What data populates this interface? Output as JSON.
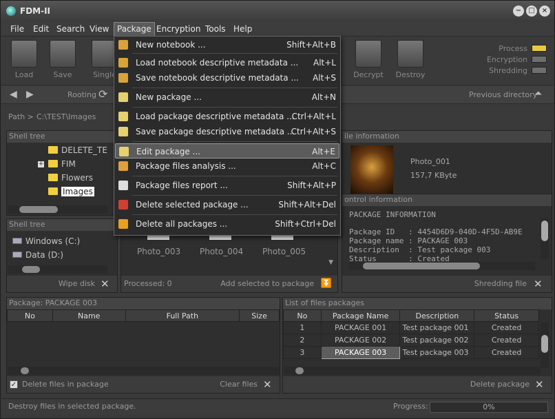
{
  "app": {
    "title": "FDM-II"
  },
  "window_buttons": {
    "minimize": "−",
    "maximize": "□",
    "close": "×"
  },
  "menubar": {
    "file": "File",
    "edit": "Edit",
    "search": "Search",
    "view": "View",
    "package": "Package",
    "encryption": "Encryption",
    "tools": "Tools",
    "help": "Help"
  },
  "toolbar": {
    "load": "Load",
    "save": "Save",
    "single": "Single",
    "decrypt": "Decrypt",
    "destroy": "Destroy"
  },
  "status_lights": {
    "process": {
      "label": "Process",
      "color": "#e8c840"
    },
    "encryption": {
      "label": "Encryption",
      "color": "#6e6e6e"
    },
    "shredding": {
      "label": "Shredding",
      "color": "#6e6e6e"
    }
  },
  "nav": {
    "rooting": "Rooting",
    "previous_directory": "Previous directory"
  },
  "path": {
    "label": "Path >",
    "value": "C:\\TEST\\Images"
  },
  "shell_tree_top": {
    "title": "Shell tree",
    "items": [
      {
        "label": "DELETE_TE"
      },
      {
        "label": "FIM"
      },
      {
        "label": "Flowers"
      },
      {
        "label": "Images"
      }
    ]
  },
  "shell_tree_bottom": {
    "title": "Shell tree",
    "drives": [
      {
        "label": "Windows (C:)"
      },
      {
        "label": "Data (D:)"
      }
    ],
    "wipe_disk": "Wipe disk"
  },
  "thumbnails": {
    "items": [
      {
        "label": "Photo_003"
      },
      {
        "label": "Photo_004"
      },
      {
        "label": "Photo_005"
      }
    ],
    "processed": "Processed: 0",
    "add_selected": "Add selected to package"
  },
  "file_info": {
    "title": "ile information",
    "name": "Photo_001",
    "size": "157,7 KByte"
  },
  "control_info": {
    "title": "ontrol information",
    "header": "PACKAGE INFORMATION",
    "rows": [
      {
        "key": "Package ID  ",
        "value": ": 4454D6D9-040D-4F5D-AB9E"
      },
      {
        "key": "Package name",
        "value": ": PACKAGE 003"
      },
      {
        "key": "Description ",
        "value": ": Test package 003"
      },
      {
        "key": "Status      ",
        "value": ": Created"
      }
    ],
    "shredding_file": "Shredding file"
  },
  "package_panel": {
    "title": "Package: PACKAGE 003",
    "columns": [
      "No",
      "Name",
      "Full Path",
      "Size"
    ],
    "delete_files_label": "Delete files in package",
    "delete_files_checked": true,
    "clear_files": "Clear files"
  },
  "packages_list": {
    "title": "List of files packages",
    "columns": [
      "No",
      "Package Name",
      "Description",
      "Status"
    ],
    "rows": [
      {
        "no": "1",
        "name": "PACKAGE 001",
        "desc": "Test package 001",
        "status": "Created"
      },
      {
        "no": "2",
        "name": "PACKAGE 002",
        "desc": "Test package 002",
        "status": "Created"
      },
      {
        "no": "3",
        "name": "PACKAGE 003",
        "desc": "Test package 003",
        "status": "Created"
      }
    ],
    "delete_package": "Delete package"
  },
  "statusbar": {
    "message": "Destroy files in selected package.",
    "progress_label": "Progress:",
    "progress_value": "0%"
  },
  "package_menu": {
    "items": [
      {
        "label": "New notebook ...",
        "shortcut": "Shift+Alt+B",
        "icon_color": "#d9a23a"
      },
      {
        "label": "Load notebook descriptive metadata ...",
        "shortcut": "Alt+L",
        "icon_color": "#d9a23a"
      },
      {
        "label": "Save notebook descriptive metadata ...",
        "shortcut": "Alt+S",
        "icon_color": "#d9a23a"
      },
      {
        "label": "New package ...",
        "shortcut": "Alt+N",
        "icon_color": "#e6d070"
      },
      {
        "label": "Load package descriptive metadata ...",
        "shortcut": "Ctrl+Alt+L",
        "icon_color": "#e6d070"
      },
      {
        "label": "Save package descriptive metadata ...",
        "shortcut": "Ctrl+Alt+S",
        "icon_color": "#e6d070"
      },
      {
        "label": "Edit package ...",
        "shortcut": "Alt+E",
        "icon_color": "#e6d070"
      },
      {
        "label": "Package files analysis ...",
        "shortcut": "Alt+C",
        "icon_color": "#e0a040"
      },
      {
        "label": "Package files report ...",
        "shortcut": "Shift+Alt+P",
        "icon_color": "#dddddd"
      },
      {
        "label": "Delete selected package ...",
        "shortcut": "Shift+Alt+Del",
        "icon_color": "#d04030"
      },
      {
        "label": "Delete all packages ...",
        "shortcut": "Shift+Ctrl+Del",
        "icon_color": "#e8a020"
      }
    ]
  }
}
